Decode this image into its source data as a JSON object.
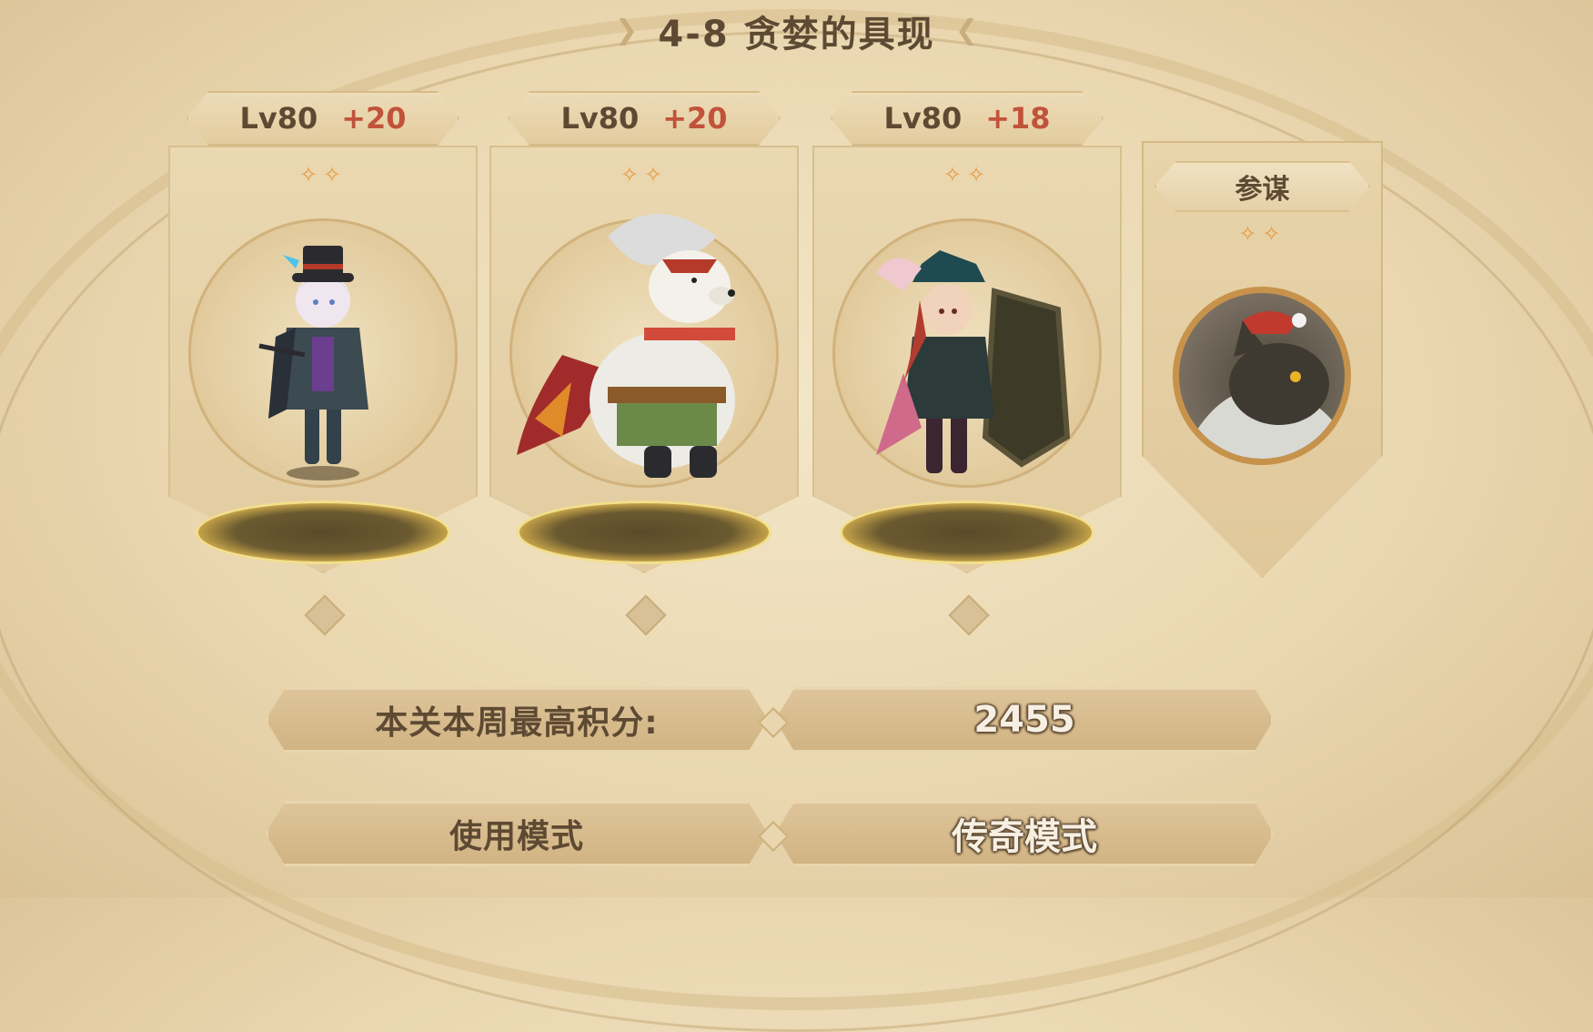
{
  "stage": {
    "title": "4-8 贪婪的具现"
  },
  "heroes": [
    {
      "level": "Lv80",
      "bonus": "+20",
      "stars": "✧✧"
    },
    {
      "level": "Lv80",
      "bonus": "+20",
      "stars": "✧✧"
    },
    {
      "level": "Lv80",
      "bonus": "+18",
      "stars": "✧✧"
    }
  ],
  "advisor": {
    "label": "参谋",
    "stars": "✧✧"
  },
  "score": {
    "label": "本关本周最高积分:",
    "value": "2455"
  },
  "modes": {
    "use_label": "使用模式",
    "current": "传奇模式"
  },
  "colors": {
    "accent_text": "#5e4a33",
    "bonus": "#c0533a",
    "star": "#e79c45",
    "gold": "#f3df8d"
  }
}
